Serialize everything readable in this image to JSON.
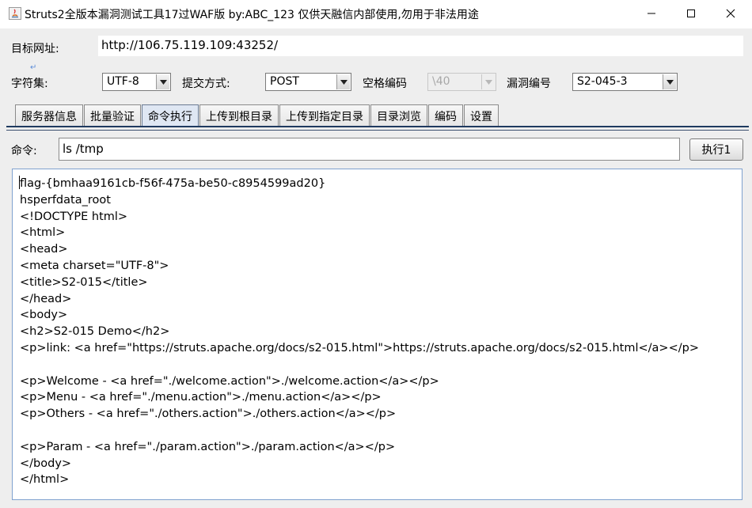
{
  "window": {
    "title": "Struts2全版本漏洞测试工具17过WAF版 by:ABC_123 仅供天融信内部使用,勿用于非法用途"
  },
  "target": {
    "label": "目标网址:",
    "value": "http://106.75.119.109:43252/"
  },
  "options": {
    "charset_label": "字符集:",
    "charset_value": "UTF-8",
    "method_label": "提交方式:",
    "method_value": "POST",
    "space_label": "空格编码",
    "space_value": "\\40",
    "vuln_label": "漏洞编号",
    "vuln_value": "S2-045-3"
  },
  "tabs": [
    {
      "label": "服务器信息"
    },
    {
      "label": "批量验证"
    },
    {
      "label": "命令执行",
      "active": true
    },
    {
      "label": "上传到根目录"
    },
    {
      "label": "上传到指定目录"
    },
    {
      "label": "目录浏览"
    },
    {
      "label": "编码"
    },
    {
      "label": "设置"
    }
  ],
  "command": {
    "label": "命令:",
    "value": "ls /tmp",
    "execute_label": "执行1"
  },
  "output": {
    "lines": [
      "flag-{bmhaa9161cb-f56f-475a-be50-c8954599ad20}",
      "hsperfdata_root",
      "<!DOCTYPE html>",
      "<html>",
      "<head>",
      "<meta charset=\"UTF-8\">",
      "<title>S2-015</title>",
      "</head>",
      "<body>",
      "<h2>S2-015 Demo</h2>",
      "<p>link: <a href=\"https://struts.apache.org/docs/s2-015.html\">https://struts.apache.org/docs/s2-015.html</a></p>",
      "",
      "<p>Welcome - <a href=\"./welcome.action\">./welcome.action</a></p>",
      "<p>Menu - <a href=\"./menu.action\">./menu.action</a></p>",
      "<p>Others - <a href=\"./others.action\">./others.action</a></p>",
      "",
      "<p>Param - <a href=\"./param.action\">./param.action</a></p>",
      "</body>",
      "</html>"
    ]
  },
  "colors": {
    "accent_border": "#7fa1cf",
    "tab_separator": "#1f3a60"
  }
}
